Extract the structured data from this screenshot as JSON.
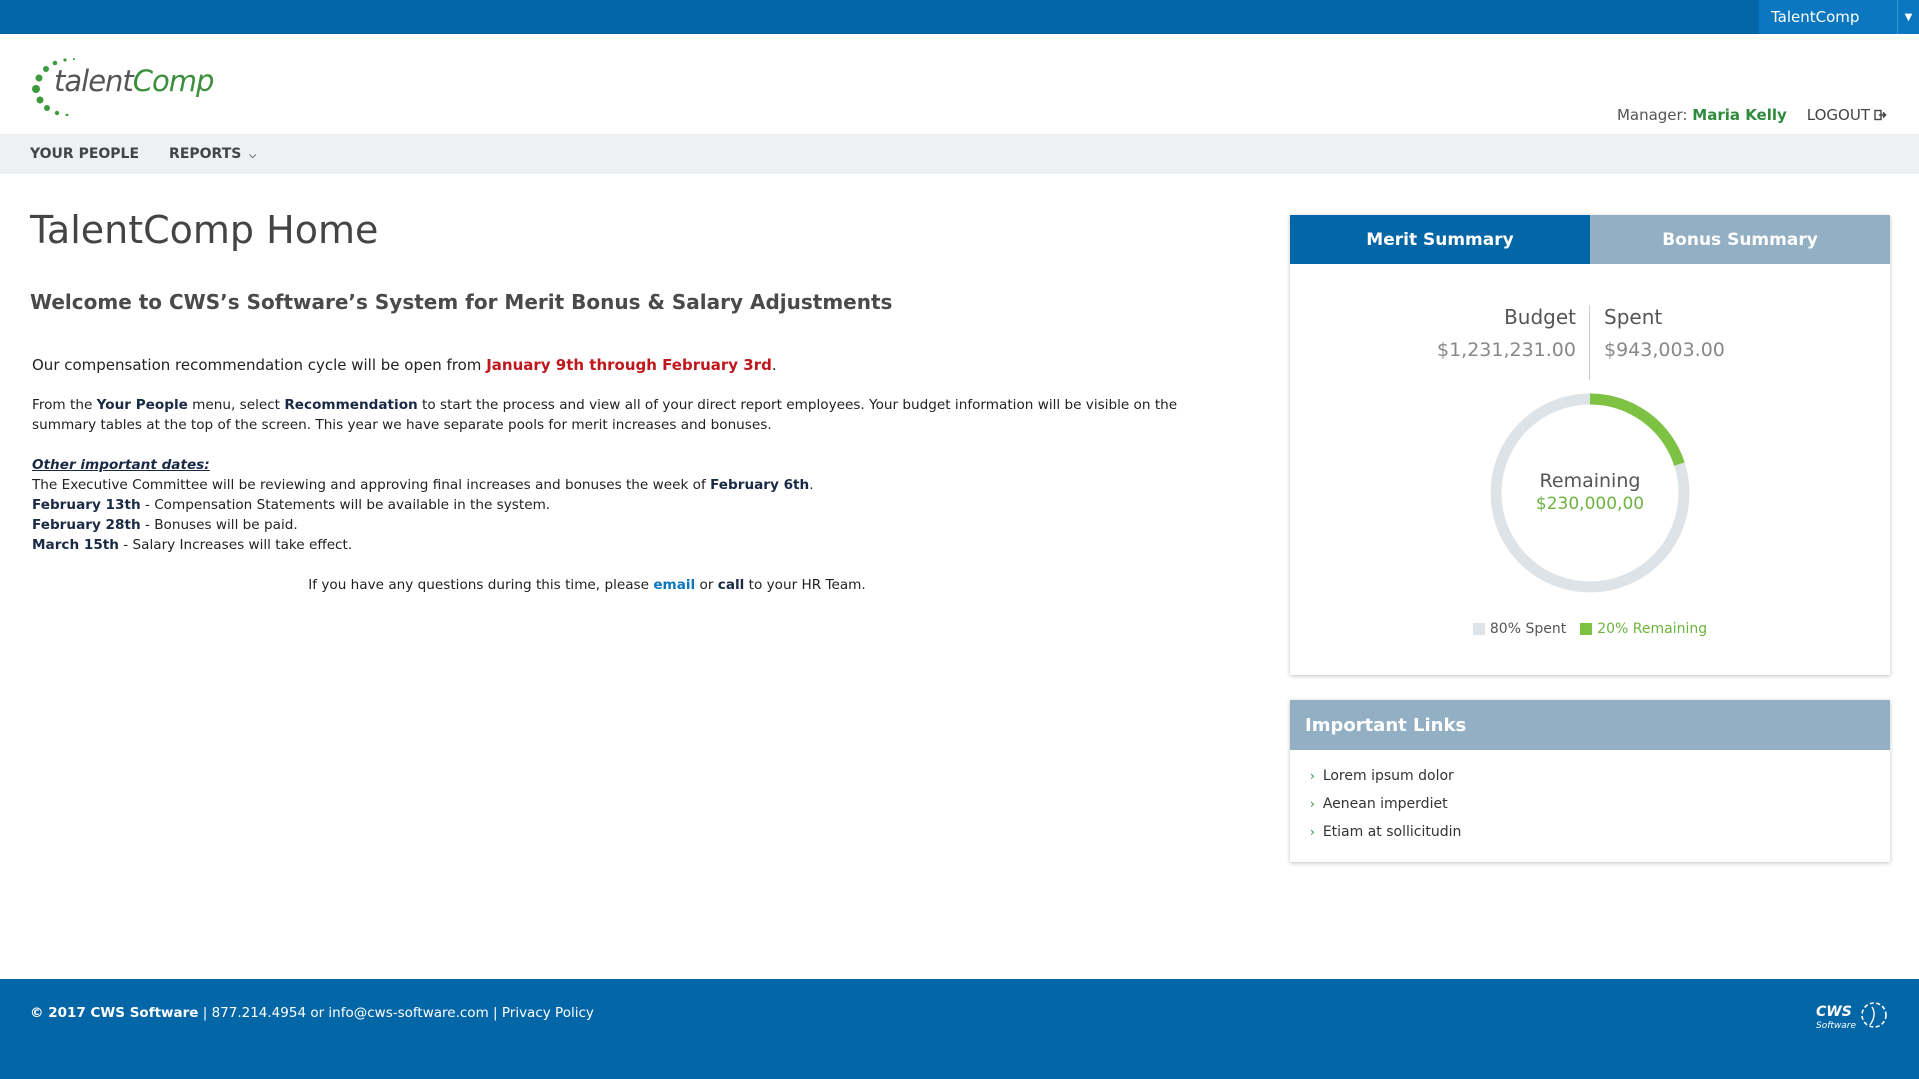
{
  "topbar": {
    "app_name": "TalentComp"
  },
  "header": {
    "logo": {
      "text_part1": "talent",
      "text_part2": "Comp"
    },
    "manager_label": "Manager:",
    "manager_name": "Maria Kelly",
    "logout_label": "LOGOUT"
  },
  "nav": {
    "items": [
      {
        "label": "YOUR PEOPLE"
      },
      {
        "label": "REPORTS"
      }
    ]
  },
  "main": {
    "title": "TalentComp Home",
    "welcome": "Welcome to CWS’s Software’s System for Merit Bonus & Salary Adjustments",
    "cycle_prefix": "Our compensation recommendation cycle will be open from ",
    "cycle_dates": "January 9th through February 3rd",
    "cycle_suffix": ".",
    "instr_1": "From the ",
    "instr_your_people": "Your People",
    "instr_2": " menu, select ",
    "instr_recommendation": "Recommendation",
    "instr_3": " to start the process and view all of your direct report employees.  Your budget information will be visible on the summary tables at the top of the screen.  This year we have separate pools for merit increases and bonuses.",
    "dates_title": "Other important dates:",
    "exec_text": "The Executive Committee will be reviewing and approving final increases and bonuses the week of ",
    "exec_date": "February 6th",
    "exec_suffix": ".",
    "date_1": "February 13th",
    "date_1_text": " - Compensation Statements will be available in the system.",
    "date_2": "February 28th",
    "date_2_text": " - Bonuses will be paid.",
    "date_3": "March 15th",
    "date_3_text": " - Salary Increases will take effect.",
    "q_prefix": "If you have any questions during this time, please ",
    "q_email": "email",
    "q_or": " or ",
    "q_call": "call",
    "q_suffix": " to your HR Team."
  },
  "summary": {
    "tabs": [
      {
        "label": "Merit Summary",
        "active": true
      },
      {
        "label": "Bonus Summary",
        "active": false
      }
    ],
    "budget_label": "Budget",
    "budget_value": "$1,231,231.00",
    "spent_label": "Spent",
    "spent_value": "$943,003.00",
    "remaining_label": "Remaining",
    "remaining_value": "$230,000,00",
    "spent_fraction": 0.8,
    "remaining_fraction": 0.2,
    "legend_spent": "80% Spent",
    "legend_remaining": "20% Remaining",
    "colors": {
      "spent": "#dde3e6",
      "remaining": "#7dc242"
    }
  },
  "links": {
    "title": "Important Links",
    "items": [
      {
        "label": "Lorem ipsum dolor"
      },
      {
        "label": "Aenean imperdiet"
      },
      {
        "label": "Etiam at sollicitudin"
      }
    ]
  },
  "footer": {
    "copyright": "© 2017 CWS Software",
    "sep1": " | ",
    "phone_email": "877.214.4954 or info@cws-software.com",
    "sep2": " | ",
    "privacy": "Privacy Policy",
    "logo_text": "CWS",
    "logo_sub": "Software"
  },
  "colors": {
    "brand_blue": "#0366a7",
    "brand_green": "#2e8b3c",
    "alert_red": "#c0171c",
    "muted_blue": "#93afc4"
  }
}
